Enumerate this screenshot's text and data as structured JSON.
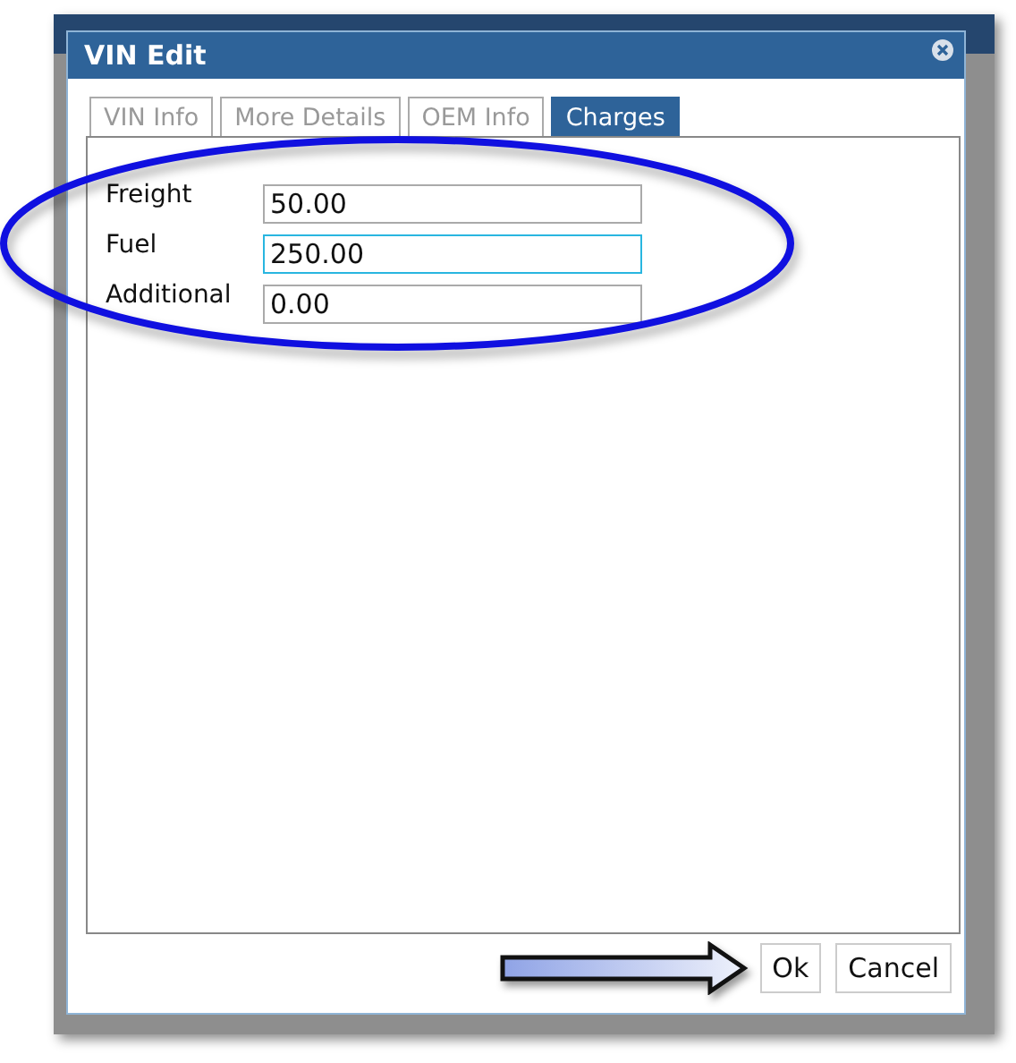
{
  "dialog": {
    "title": "VIN Edit"
  },
  "tabs": [
    {
      "label": "VIN Info",
      "selected": false
    },
    {
      "label": "More Details",
      "selected": false
    },
    {
      "label": "OEM Info",
      "selected": false
    },
    {
      "label": "Charges",
      "selected": true
    }
  ],
  "fields": [
    {
      "label": "Freight",
      "value": "50.00",
      "focused": false
    },
    {
      "label": "Fuel",
      "value": "250.00",
      "focused": true
    },
    {
      "label": "Additional",
      "value": "0.00",
      "focused": false
    }
  ],
  "buttons": [
    "Ok",
    "Cancel"
  ]
}
